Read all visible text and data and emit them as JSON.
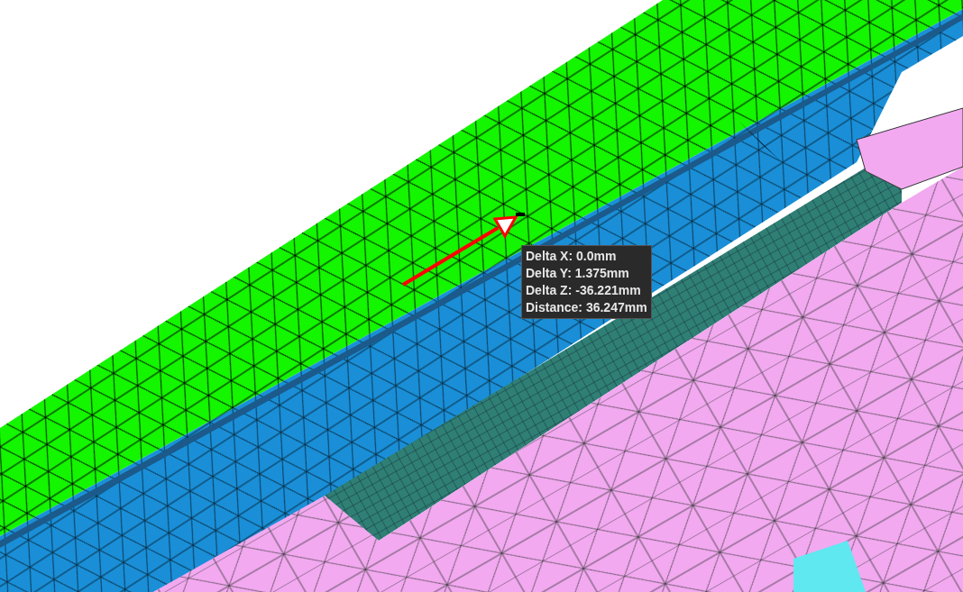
{
  "measurement_tooltip": {
    "lines": [
      "Delta X: 0.0mm",
      "Delta Y: 1.375mm",
      "Delta Z: -36.221mm",
      "Distance: 36.247mm"
    ]
  }
}
